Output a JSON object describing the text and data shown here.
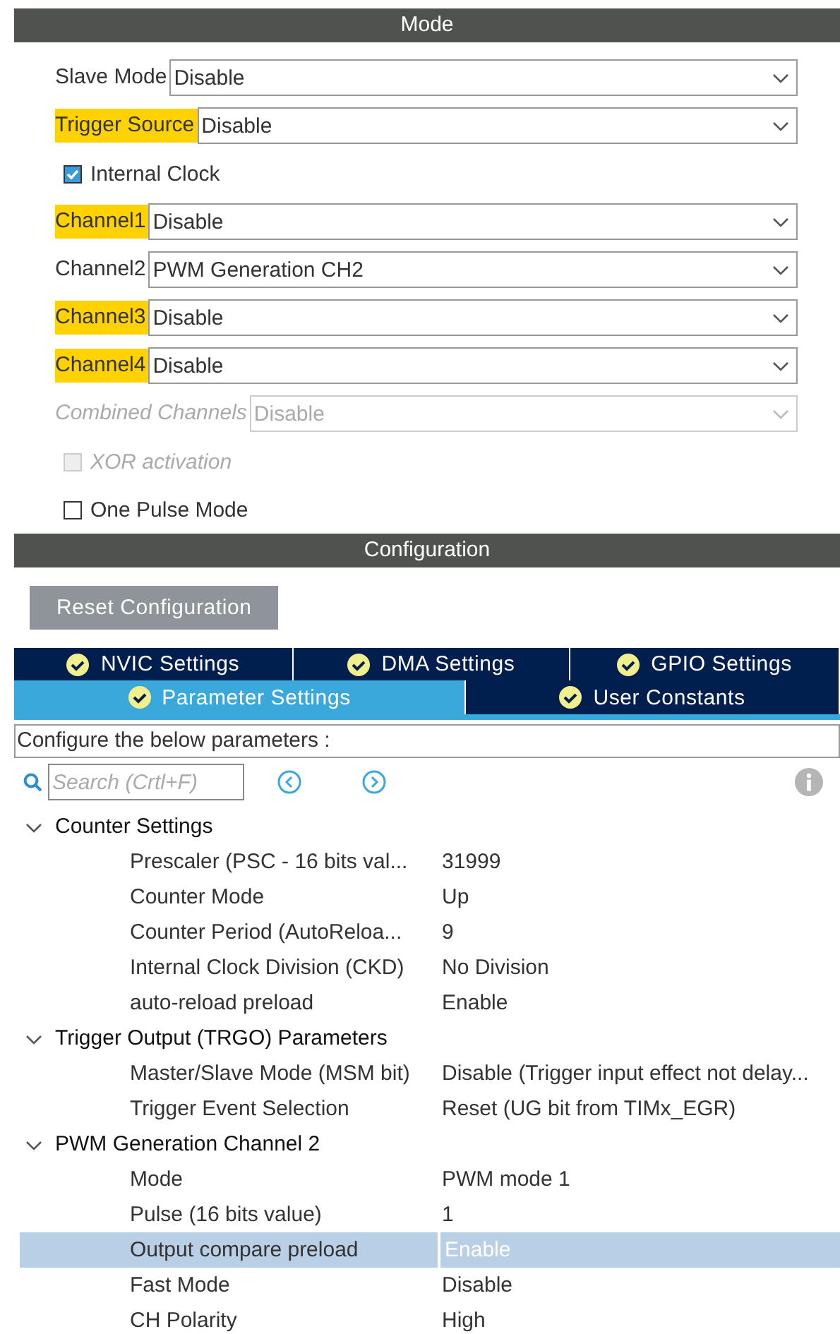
{
  "mode": {
    "title": "Mode",
    "rows": [
      {
        "kind": "select",
        "label": "Slave Mode",
        "value": "Disable",
        "highlighted": false,
        "disabled": false
      },
      {
        "kind": "select",
        "label": "Trigger Source",
        "value": "Disable",
        "highlighted": true,
        "disabled": false
      },
      {
        "kind": "checkbox",
        "label": "Internal Clock",
        "checked": true,
        "disabled": false
      },
      {
        "kind": "select",
        "label": "Channel1",
        "value": "Disable",
        "highlighted": true,
        "disabled": false
      },
      {
        "kind": "select",
        "label": "Channel2",
        "value": "PWM Generation CH2",
        "highlighted": false,
        "disabled": false
      },
      {
        "kind": "select",
        "label": "Channel3",
        "value": "Disable",
        "highlighted": true,
        "disabled": false
      },
      {
        "kind": "select",
        "label": "Channel4",
        "value": "Disable",
        "highlighted": true,
        "disabled": false
      },
      {
        "kind": "select",
        "label": "Combined Channels",
        "value": "Disable",
        "highlighted": false,
        "disabled": true
      },
      {
        "kind": "checkbox",
        "label": "XOR activation",
        "checked": false,
        "disabled": true
      },
      {
        "kind": "checkbox",
        "label": "One Pulse Mode",
        "checked": false,
        "disabled": false
      }
    ]
  },
  "configuration": {
    "title": "Configuration",
    "reset_button": "Reset Configuration",
    "tab_rows": [
      [
        {
          "label": "NVIC Settings",
          "selected": false
        },
        {
          "label": "DMA Settings",
          "selected": false
        },
        {
          "label": "GPIO Settings",
          "selected": false
        }
      ],
      [
        {
          "label": "Parameter Settings",
          "selected": true
        },
        {
          "label": "User Constants",
          "selected": false
        }
      ]
    ],
    "description": "Configure the below parameters :",
    "search": {
      "placeholder": "Search (Crtl+F)"
    },
    "groups": [
      {
        "label": "Counter Settings",
        "expanded": true,
        "children": [
          {
            "name": "Prescaler (PSC - 16 bits val...",
            "value": "31999",
            "selected": false
          },
          {
            "name": "Counter Mode",
            "value": "Up",
            "selected": false
          },
          {
            "name": "Counter Period (AutoReloa...",
            "value": "9",
            "selected": false
          },
          {
            "name": "Internal Clock Division (CKD)",
            "value": "No Division",
            "selected": false
          },
          {
            "name": "auto-reload preload",
            "value": "Enable",
            "selected": false
          }
        ]
      },
      {
        "label": "Trigger Output (TRGO) Parameters",
        "expanded": true,
        "children": [
          {
            "name": "Master/Slave Mode (MSM bit)",
            "value": "Disable (Trigger input effect not delay...",
            "selected": false
          },
          {
            "name": "Trigger Event Selection",
            "value": "Reset (UG bit from TIMx_EGR)",
            "selected": false
          }
        ]
      },
      {
        "label": "PWM Generation Channel 2",
        "expanded": true,
        "children": [
          {
            "name": "Mode",
            "value": "PWM mode 1",
            "selected": false
          },
          {
            "name": "Pulse (16 bits value)",
            "value": "1",
            "selected": false
          },
          {
            "name": "Output compare preload",
            "value": "Enable",
            "selected": true
          },
          {
            "name": "Fast Mode",
            "value": "Disable",
            "selected": false
          },
          {
            "name": "CH Polarity",
            "value": "High",
            "selected": false
          }
        ]
      }
    ]
  }
}
